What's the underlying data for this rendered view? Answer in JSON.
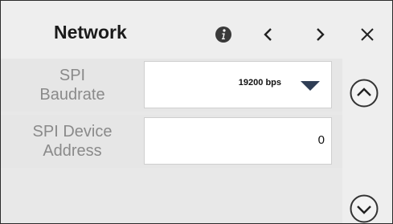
{
  "header": {
    "title": "Network",
    "info_icon": "info-icon",
    "prev_icon": "chevron-left-icon",
    "next_icon": "chevron-right-icon",
    "close_icon": "close-icon"
  },
  "settings": [
    {
      "label": "SPI\nBaudrate",
      "type": "select",
      "value": "19200 bps",
      "icon": "dropdown-caret-icon"
    },
    {
      "label": "SPI Device\nAddress",
      "type": "input",
      "value": "0"
    }
  ],
  "scroll": {
    "up_icon": "chevron-up-circle-icon",
    "down_icon": "chevron-down-circle-icon"
  },
  "colors": {
    "background": "#eeeeee",
    "label": "#8a8a8a",
    "title": "#1a1a1a",
    "icon": "#333333"
  }
}
